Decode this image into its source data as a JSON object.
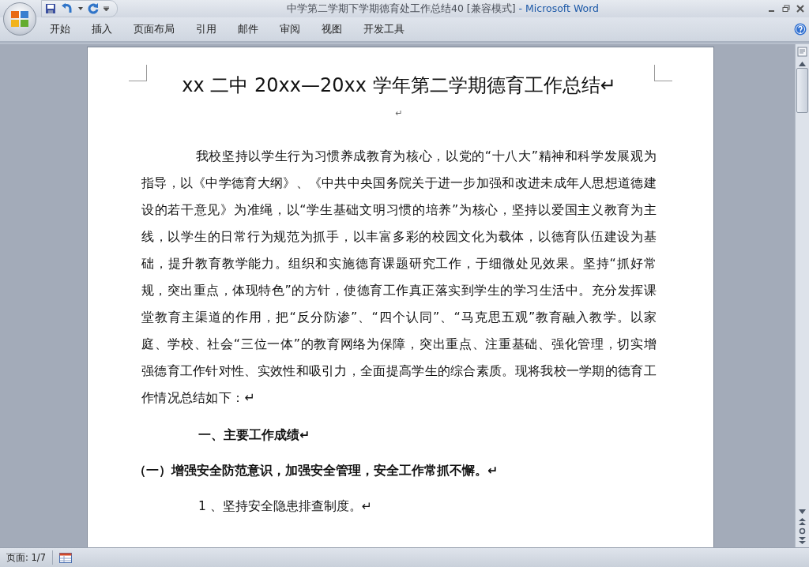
{
  "window": {
    "title": "中学第二学期下学期德育处工作总结40 [兼容模式]",
    "separator": "-",
    "app_name": "Microsoft Word"
  },
  "ribbon_tabs": [
    {
      "label": "开始"
    },
    {
      "label": "插入"
    },
    {
      "label": "页面布局"
    },
    {
      "label": "引用"
    },
    {
      "label": "邮件"
    },
    {
      "label": "审阅"
    },
    {
      "label": "视图"
    },
    {
      "label": "开发工具"
    }
  ],
  "document": {
    "title": "xx 二中 20xx—20xx 学年第二学期德育工作总结↵",
    "paragraphs": [
      {
        "kind": "blank",
        "text": "↵"
      },
      {
        "kind": "body",
        "text": "我校坚持以学生行为习惯养成教育为核心，以党的“十八大”精神和科学发展观为指导，以《中学德育大纲》、《中共中央国务院关于进一步加强和改进未成年人思想道德建设的若干意见》为准绳，以“学生基础文明习惯的培养”为核心，坚持以爱国主义教育为主线，以学生的日常行为规范为抓手，以丰富多彩的校园文化为载体，以德育队伍建设为基础，提升教育教学能力。组织和实施德育课题研究工作，于细微处见效果。坚持“抓好常规，突出重点，体现特色”的方针，使德育工作真正落实到学生的学习生活中。充分发挥课堂教育主渠道的作用，把“反分防渗”、“四个认同”、“马克思五观”教育融入教学。以家庭、学校、社会“三位一体”的教育网络为保障，突出重点、注重基础、强化管理，切实增强德育工作针对性、实效性和吸引力，全面提高学生的综合素质。现将我校一学期的德育工作情况总结如下：↵"
      },
      {
        "kind": "heading",
        "text": "一、主要工作成绩↵"
      },
      {
        "kind": "subheading",
        "text": "（一）增强安全防范意识，加强安全管理，安全工作常抓不懈。↵"
      },
      {
        "kind": "item",
        "text": "1 、坚持安全隐患排查制度。↵"
      }
    ]
  },
  "status_bar": {
    "page": "页面: 1/7"
  }
}
